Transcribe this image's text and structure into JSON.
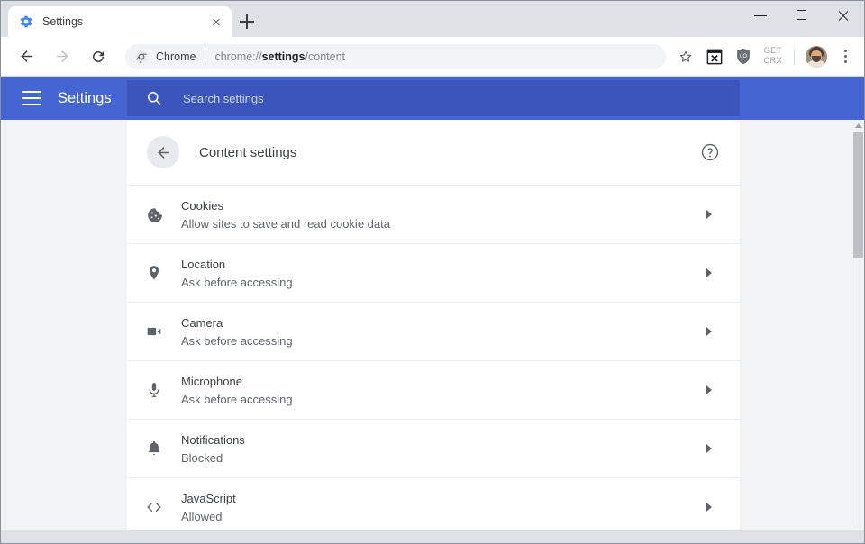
{
  "window": {
    "controls": {
      "minimize": "minimize-button",
      "maximize": "maximize-button",
      "close": "close-button"
    }
  },
  "tabstrip": {
    "tabs": [
      {
        "title": "Settings",
        "favicon": "settings-gear-icon",
        "active": true
      }
    ],
    "new_tab_label": "+"
  },
  "toolbar": {
    "back_icon": "back-arrow-icon",
    "forward_icon": "forward-arrow-icon",
    "reload_icon": "reload-icon",
    "omnibox": {
      "site_icon": "chrome-logo-icon",
      "scheme_label": "Chrome",
      "url_prefix": "chrome://",
      "url_bold": "settings",
      "url_suffix": "/content",
      "full_url": "chrome://settings/content"
    },
    "bookmark_icon": "star-icon",
    "extension_icon": "extension-x-icon",
    "shield_icon": "ublock-shield-icon",
    "get_crx_line1": "GET",
    "get_crx_line2": "CRX",
    "profile_icon": "profile-avatar",
    "menu_icon": "three-dot-menu-icon"
  },
  "settings_header": {
    "menu_icon": "hamburger-menu-icon",
    "title": "Settings",
    "search": {
      "icon": "search-icon",
      "placeholder": "Search settings",
      "value": ""
    },
    "background_color": "#4465d2",
    "search_background_color": "#3c55bd"
  },
  "content": {
    "back_icon": "back-arrow-icon",
    "page_title": "Content settings",
    "help_icon": "help-question-icon",
    "rows": [
      {
        "icon": "cookie-icon",
        "title": "Cookies",
        "subtitle": "Allow sites to save and read cookie data",
        "arrow": "chevron-right-icon"
      },
      {
        "icon": "location-pin-icon",
        "title": "Location",
        "subtitle": "Ask before accessing",
        "arrow": "chevron-right-icon"
      },
      {
        "icon": "video-camera-icon",
        "title": "Camera",
        "subtitle": "Ask before accessing",
        "arrow": "chevron-right-icon"
      },
      {
        "icon": "microphone-icon",
        "title": "Microphone",
        "subtitle": "Ask before accessing",
        "arrow": "chevron-right-icon"
      },
      {
        "icon": "bell-icon",
        "title": "Notifications",
        "subtitle": "Blocked",
        "arrow": "chevron-right-icon"
      },
      {
        "icon": "code-brackets-icon",
        "title": "JavaScript",
        "subtitle": "Allowed",
        "arrow": "chevron-right-icon"
      }
    ]
  },
  "scrollbar": {
    "up_arrow": "scroll-up-arrow",
    "thumb_position_percent": 0
  }
}
